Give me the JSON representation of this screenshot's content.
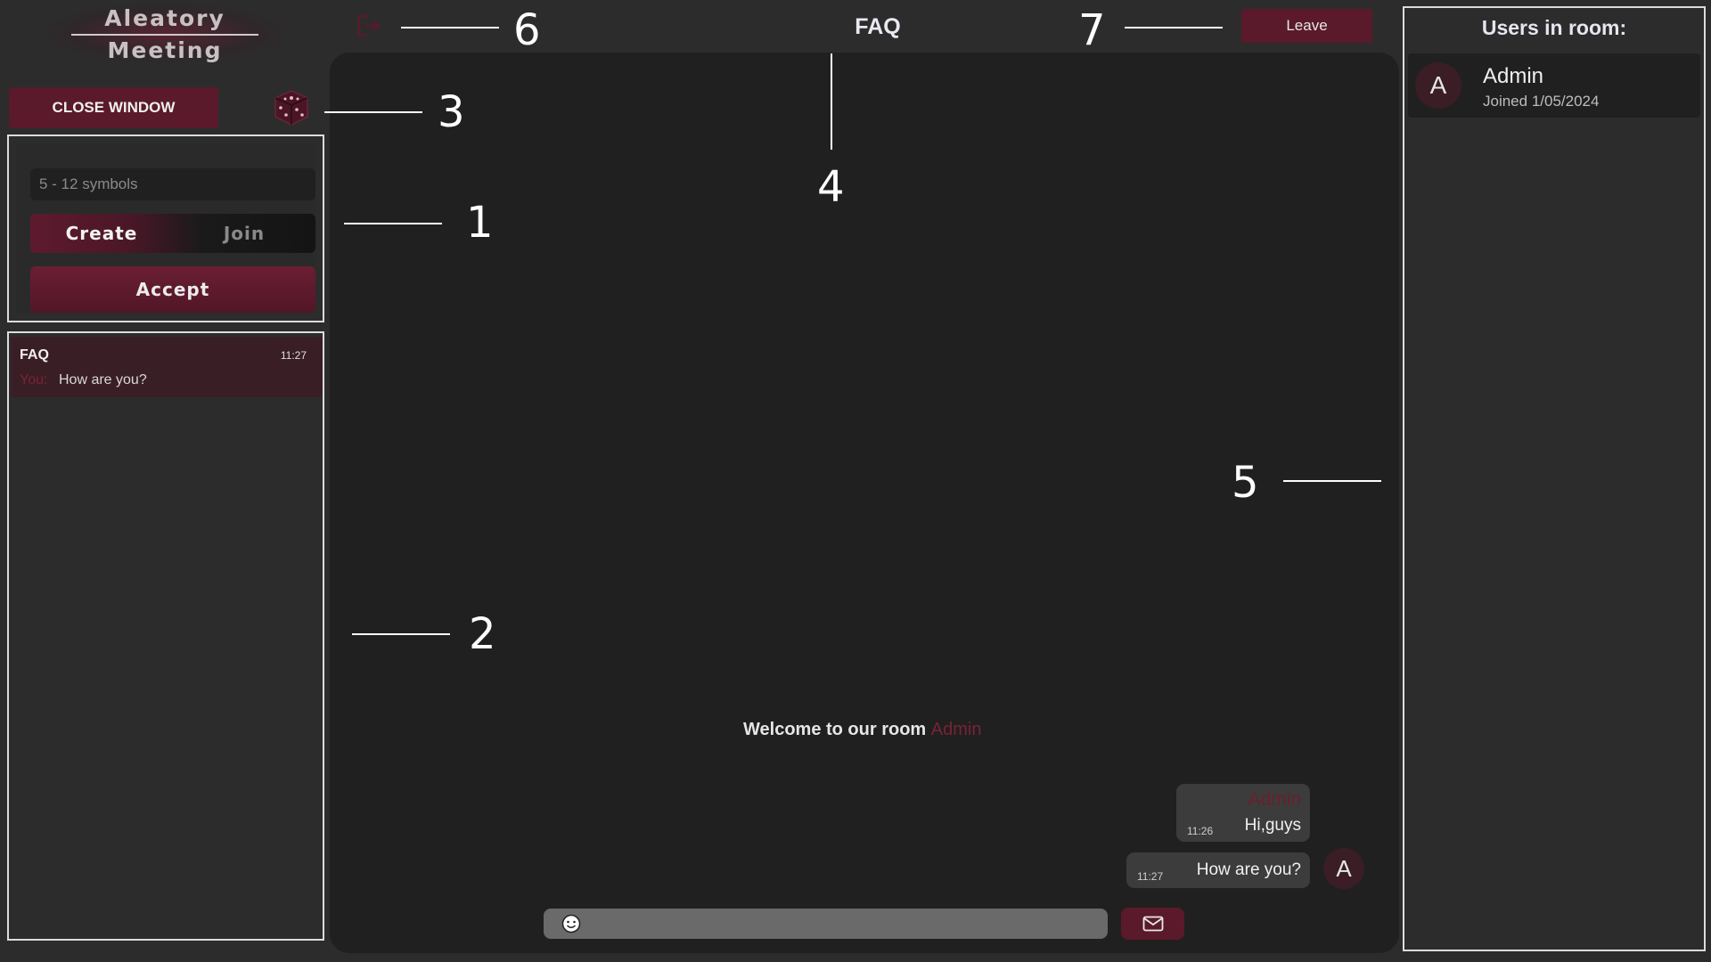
{
  "logo": {
    "line1": "Aleatory",
    "line2": "Meeting"
  },
  "sidebar": {
    "close_label": "CLOSE WINDOW",
    "room_input_placeholder": "5 - 12 symbols",
    "room_input_value": "",
    "mode_create": "Create",
    "mode_join": "Join",
    "accept_label": "Accept",
    "chats": [
      {
        "name": "FAQ",
        "time": "11:27",
        "sender": "You:",
        "preview": "How are you?"
      }
    ]
  },
  "header": {
    "room_title": "FAQ",
    "leave_label": "Leave"
  },
  "chat": {
    "welcome_text": "Welcome to our room",
    "welcome_name": "Admin",
    "messages": [
      {
        "sender": "Admin",
        "time": "11:26",
        "text": "Hi,guys"
      },
      {
        "sender": "",
        "time": "11:27",
        "text": "How are you?"
      }
    ],
    "avatar_letter": "A",
    "input_value": ""
  },
  "users": {
    "title": "Users in room:",
    "list": [
      {
        "initial": "A",
        "name": "Admin",
        "joined": "Joined 1/05/2024"
      }
    ]
  },
  "annotations": [
    "1",
    "2",
    "3",
    "4",
    "5",
    "6",
    "7"
  ],
  "icons": [
    "exit-icon",
    "dice-icon",
    "emoji-icon",
    "mail-icon"
  ],
  "colors": {
    "accent": "#5a1a2b",
    "accent_text": "#7a2236",
    "background": "#2c2c2c",
    "chat_bg": "#202020"
  }
}
